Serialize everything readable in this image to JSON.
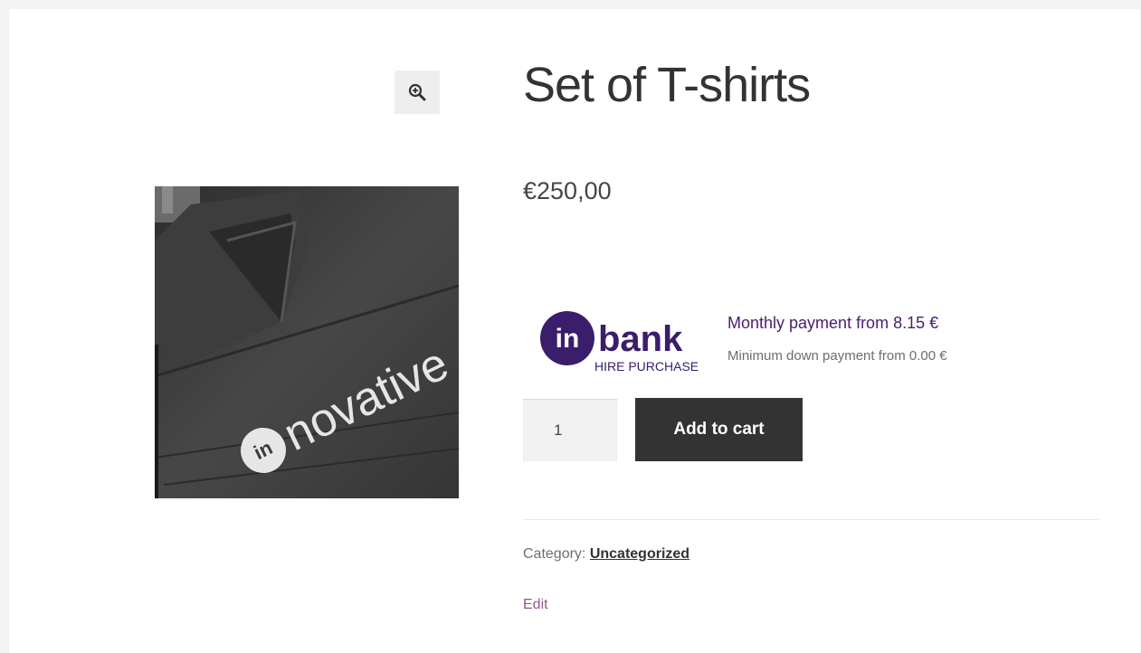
{
  "product": {
    "title": "Set of T-shirts",
    "price": "€250,00",
    "image_text": "in novative"
  },
  "inbank": {
    "logo_word": "bank",
    "logo_sub": "HIRE PURCHASE",
    "monthly": "Monthly payment from 8.15 €",
    "downpayment": "Minimum down payment from 0.00 €"
  },
  "cart": {
    "quantity": "1",
    "add_label": "Add to cart"
  },
  "meta": {
    "category_label": "Category:",
    "category_value": "Uncategorized",
    "edit_label": "Edit"
  },
  "icons": {
    "zoom": "zoom-in-icon"
  },
  "colors": {
    "button_bg": "#333333",
    "inbank_purple": "#4a1b6e",
    "link_purple": "#96588a"
  }
}
